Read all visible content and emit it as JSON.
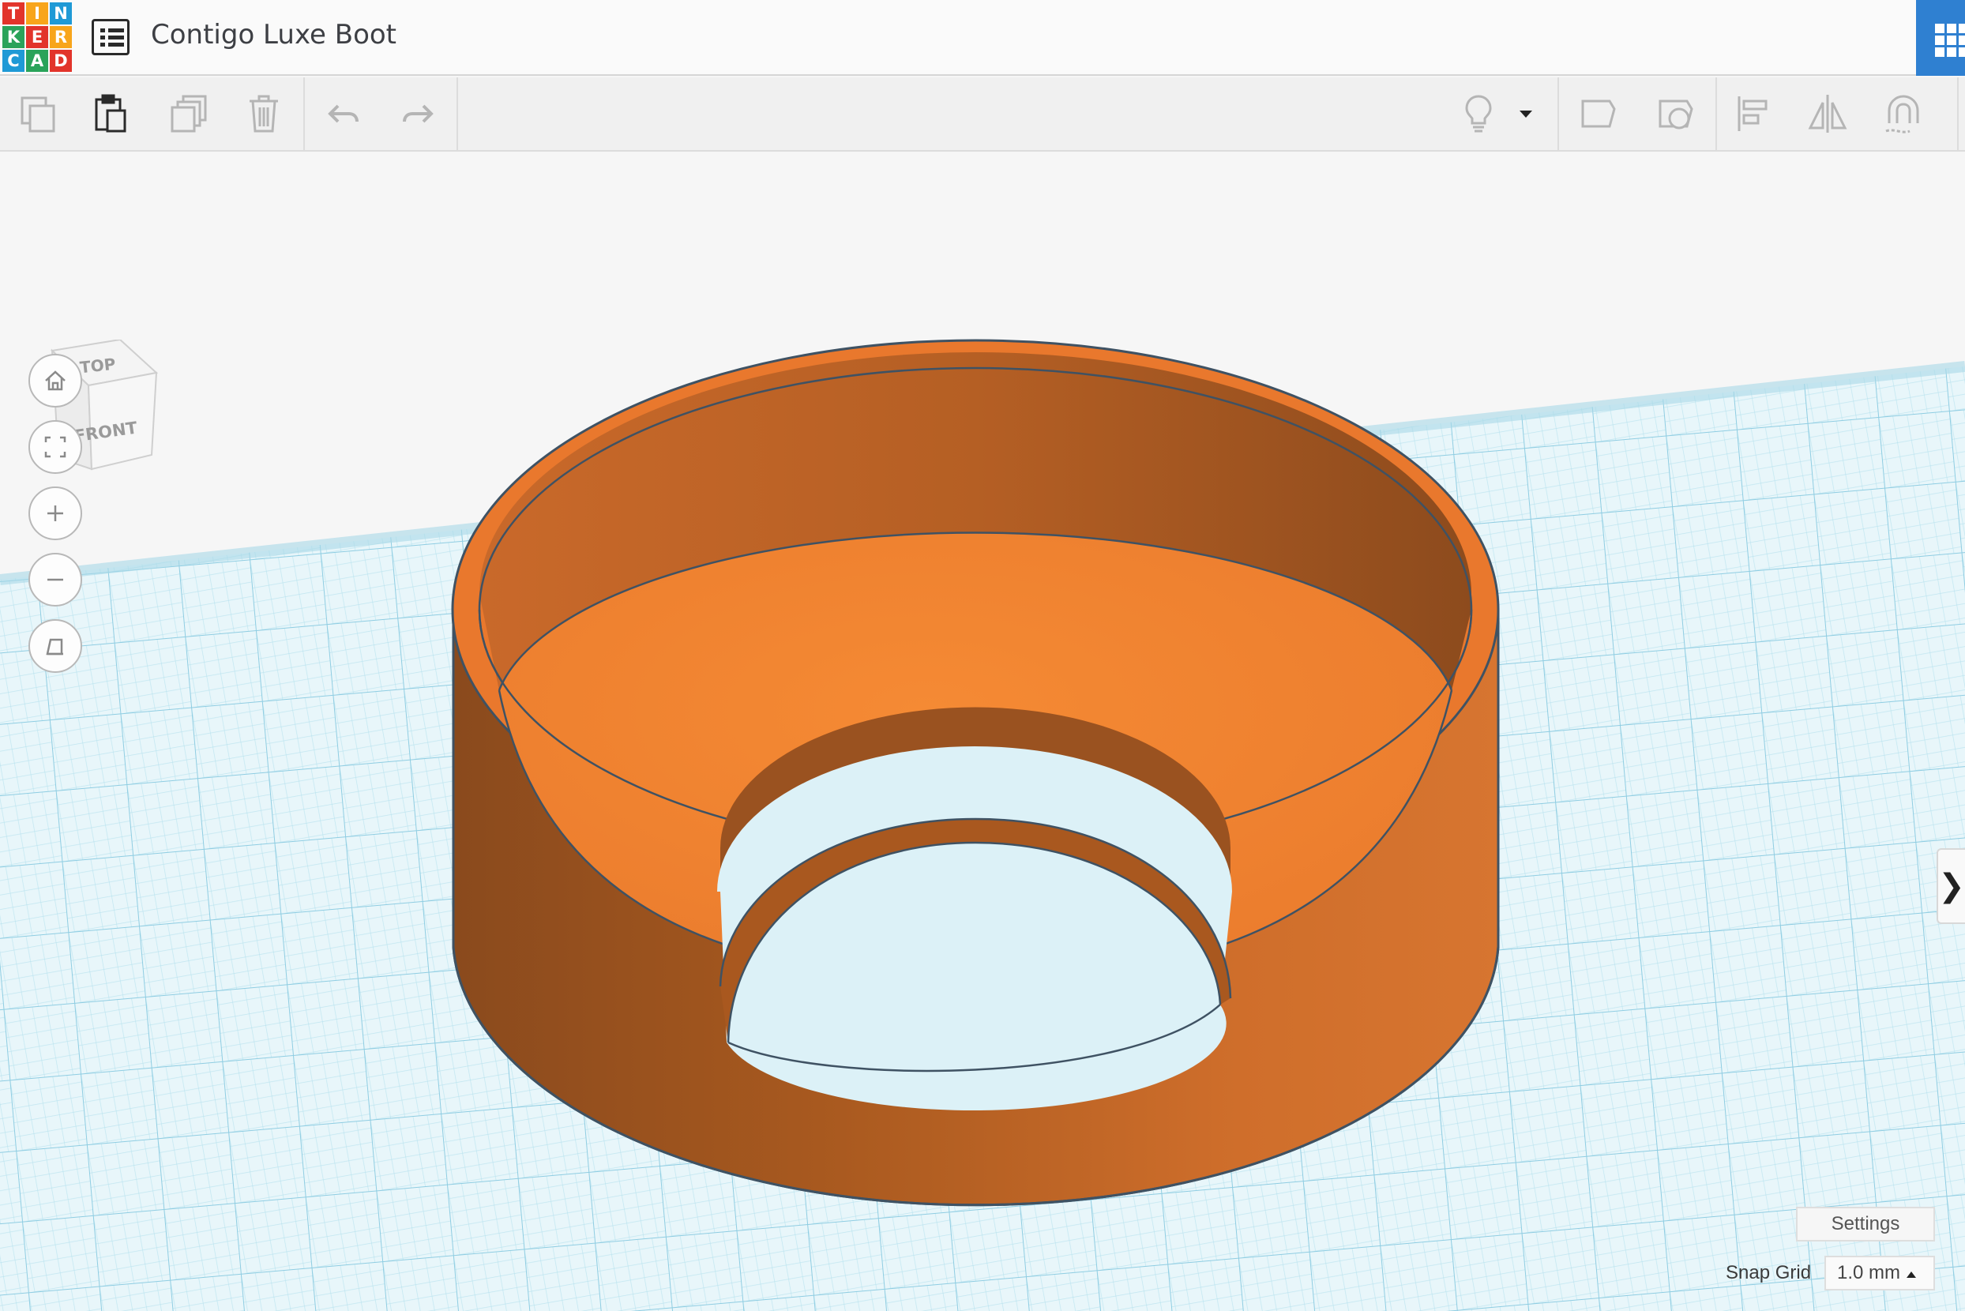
{
  "app": {
    "logo_letters": [
      "T",
      "I",
      "N",
      "K",
      "E",
      "R",
      "C",
      "A",
      "D"
    ],
    "document_title": "Contigo Luxe Boot"
  },
  "toolbar": {
    "left_icons": [
      "copy-icon",
      "paste-icon",
      "duplicate-icon",
      "delete-icon",
      "undo-icon",
      "redo-icon"
    ],
    "right_icons": [
      "lightbulb-icon",
      "dropdown-caret-icon",
      "note-shape-icon",
      "note-solid-icon",
      "align-icon",
      "mirror-icon",
      "magnet-icon"
    ]
  },
  "viewcube": {
    "top_label": "TOP",
    "front_label": "FRONT"
  },
  "nav": [
    "home-icon",
    "fit-view-icon",
    "zoom-in-icon",
    "zoom-out-icon",
    "perspective-icon"
  ],
  "panel_toggle": "❯",
  "settings": {
    "label": "Settings"
  },
  "snap": {
    "label": "Snap Grid",
    "value": "1.0 mm"
  },
  "colors": {
    "shape": "#e57a2e",
    "grid": "#cfeef5",
    "accent": "#2f80d1"
  }
}
